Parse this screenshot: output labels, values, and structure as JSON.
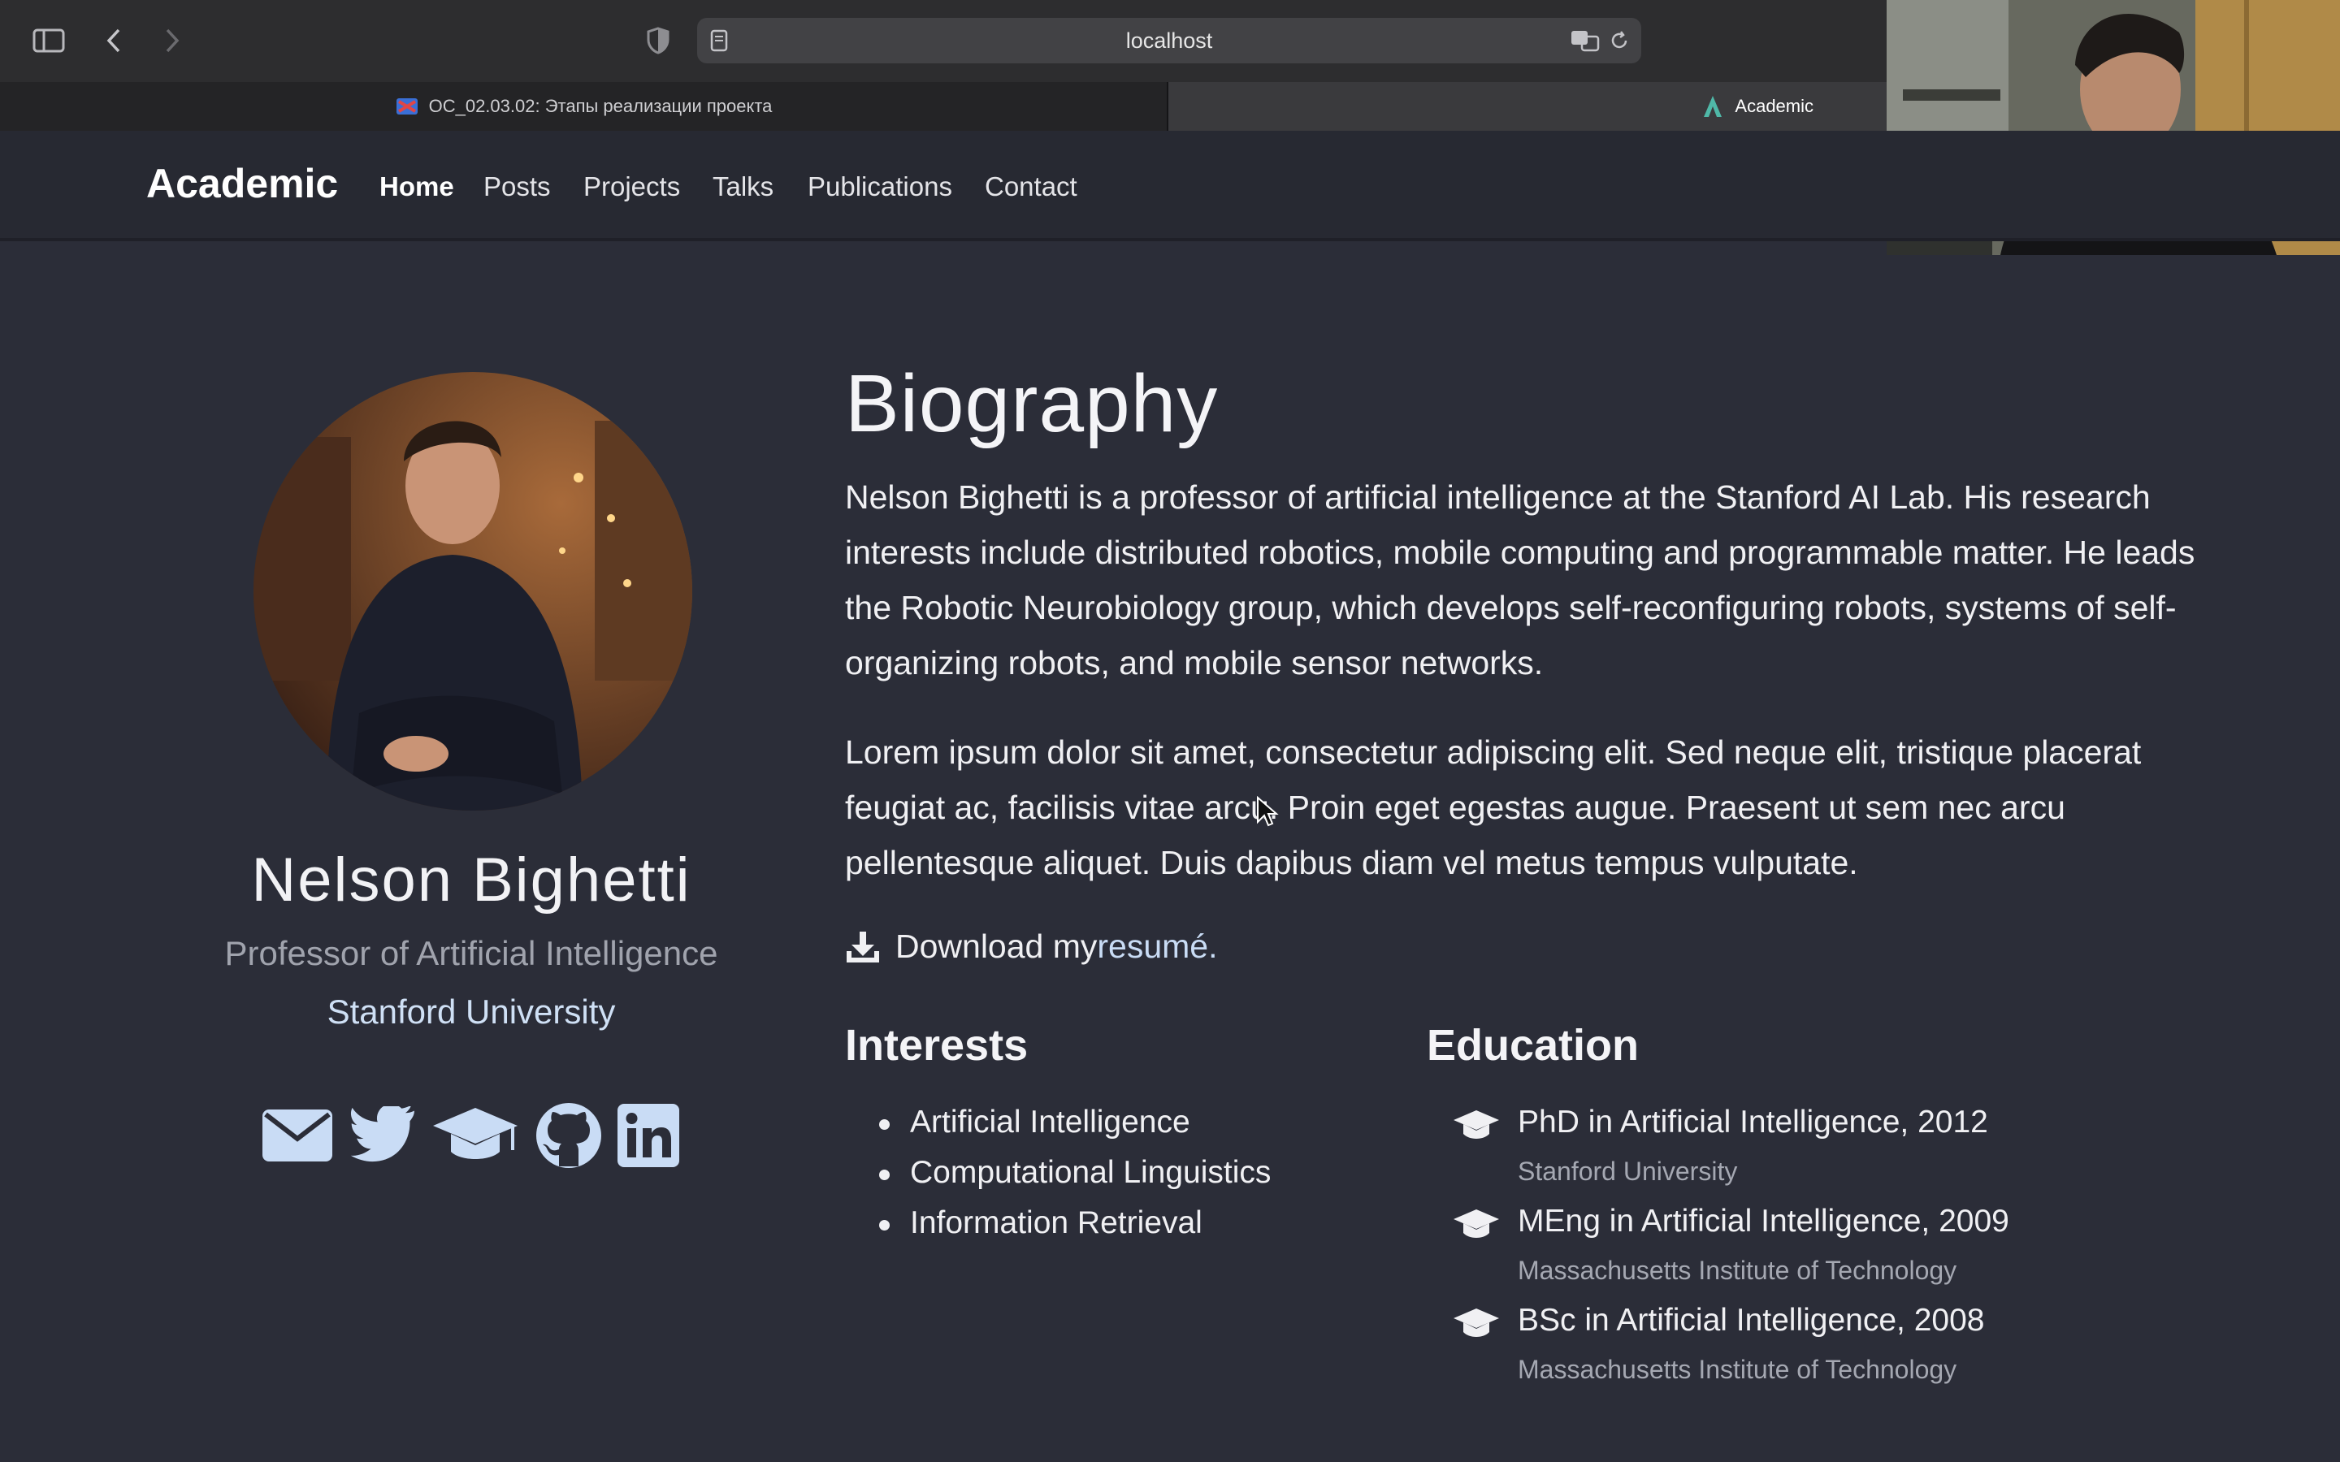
{
  "browser": {
    "address": "localhost",
    "tabs": [
      {
        "label": "ОС_02.03.02: Этапы реализации проекта"
      },
      {
        "label": "Academic"
      }
    ]
  },
  "nav": {
    "brand": "Academic",
    "links": [
      "Home",
      "Posts",
      "Projects",
      "Talks",
      "Publications",
      "Contact"
    ],
    "active": "Home"
  },
  "profile": {
    "name": "Nelson Bighetti",
    "role": "Professor of Artificial Intelligence",
    "organization": "Stanford University",
    "social": [
      "envelope-icon",
      "twitter-icon",
      "graduation-cap-icon",
      "github-icon",
      "linkedin-icon"
    ],
    "icon_color": "#c9dcf5"
  },
  "bio": {
    "title": "Biography",
    "paragraphs": [
      "Nelson Bighetti is a professor of artificial intelligence at the Stanford AI Lab. His research interests include distributed robotics, mobile computing and programmable matter. He leads the Robotic Neurobiology group, which develops self-reconfiguring robots, systems of self-organizing robots, and mobile sensor networks.",
      "Lorem ipsum dolor sit amet, consectetur adipiscing elit. Sed neque elit, tristique placerat feugiat ac, facilisis vitae arcu. Proin eget egestas augue. Praesent ut sem nec arcu pellentesque aliquet. Duis dapibus diam vel metus tempus vulputate."
    ],
    "download_text": "Download my ",
    "download_link": "resumé",
    "download_end": "."
  },
  "interests": {
    "title": "Interests",
    "items": [
      "Artificial Intelligence",
      "Computational Linguistics",
      "Information Retrieval"
    ]
  },
  "education": {
    "title": "Education",
    "items": [
      {
        "course": "PhD in Artificial Intelligence, 2012",
        "institution": "Stanford University"
      },
      {
        "course": "MEng in Artificial Intelligence, 2009",
        "institution": "Massachusetts Institute of Technology"
      },
      {
        "course": "BSc in Artificial Intelligence, 2008",
        "institution": "Massachusetts Institute of Technology"
      }
    ]
  },
  "colors": {
    "page_bg": "#2b2d38",
    "navbar_bg": "#272932",
    "link": "#c9dcf5"
  }
}
